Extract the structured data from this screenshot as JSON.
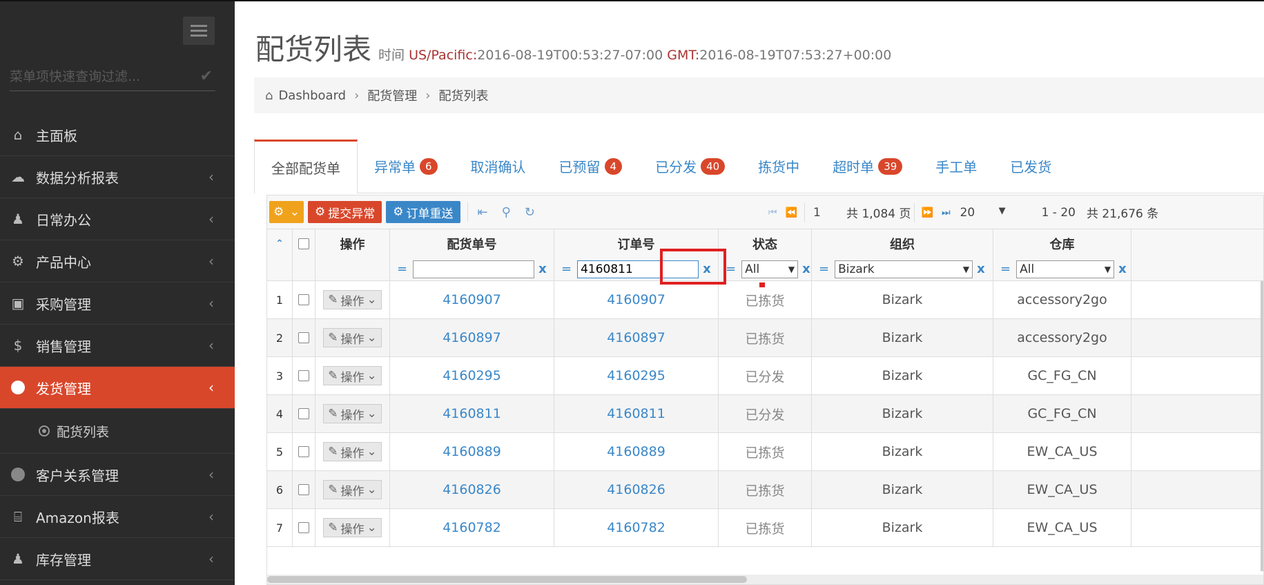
{
  "sidebar": {
    "search_placeholder": "菜单项快速查询过滤...",
    "items": [
      {
        "label": "主面板",
        "icon": "home-icon",
        "glyph": "⌂",
        "chevron": false
      },
      {
        "label": "数据分析报表",
        "icon": "cloud-icon",
        "glyph": "☁",
        "chevron": true
      },
      {
        "label": "日常办公",
        "icon": "android-icon",
        "glyph": "♟",
        "chevron": true
      },
      {
        "label": "产品中心",
        "icon": "gears-icon",
        "glyph": "⚙",
        "chevron": true
      },
      {
        "label": "采购管理",
        "icon": "cube-icon",
        "glyph": "▣",
        "chevron": true
      },
      {
        "label": "销售管理",
        "icon": "dollar-icon",
        "glyph": "$",
        "chevron": true
      },
      {
        "label": "发货管理",
        "icon": "circle-icon",
        "glyph": "",
        "chevron": true,
        "active": true
      },
      {
        "label": "客户关系管理",
        "icon": "circle-icon",
        "glyph": "",
        "chevron": true
      },
      {
        "label": "Amazon报表",
        "icon": "bank-icon",
        "glyph": "⌸",
        "chevron": true
      },
      {
        "label": "库存管理",
        "icon": "android-icon",
        "glyph": "♟",
        "chevron": true
      }
    ],
    "sub_item": "配货列表"
  },
  "header": {
    "title": "配货列表",
    "time_label": "时间",
    "tz1": "US/Pacific:",
    "time1": "2016-08-19T00:53:27-07:00",
    "tz2": "GMT:",
    "time2": "2016-08-19T07:53:27+00:00"
  },
  "breadcrumb": [
    "Dashboard",
    "配货管理",
    "配货列表"
  ],
  "tabs": [
    {
      "label": "全部配货单",
      "badge": "",
      "active": true
    },
    {
      "label": "异常单",
      "badge": "6"
    },
    {
      "label": "取消确认",
      "badge": ""
    },
    {
      "label": "已预留",
      "badge": "4"
    },
    {
      "label": "已分发",
      "badge": "40"
    },
    {
      "label": "拣货中",
      "badge": ""
    },
    {
      "label": "超时单",
      "badge": "39"
    },
    {
      "label": "手工单",
      "badge": ""
    },
    {
      "label": "已发货",
      "badge": ""
    }
  ],
  "toolbar": {
    "submit_exception": "提交异常",
    "resend_order": "订单重送"
  },
  "pager": {
    "page": "1",
    "total_pages": "共 1,084 页",
    "page_size": "20",
    "range": "1 - 20",
    "total": "共 21,676 条"
  },
  "columns": {
    "op": "操作",
    "alloc_no": "配货单号",
    "order_no": "订单号",
    "status": "状态",
    "org": "组织",
    "warehouse": "仓库"
  },
  "filters": {
    "alloc_no": "",
    "order_no": "4160811",
    "status": "All",
    "org": "Bizark",
    "warehouse": "All",
    "eq": "=",
    "clear": "x"
  },
  "op_label": "操作",
  "rows": [
    {
      "n": "1",
      "alloc": "4160907",
      "order": "4160907",
      "status": "已拣货",
      "org": "Bizark",
      "wh": "accessory2go"
    },
    {
      "n": "2",
      "alloc": "4160897",
      "order": "4160897",
      "status": "已拣货",
      "org": "Bizark",
      "wh": "accessory2go"
    },
    {
      "n": "3",
      "alloc": "4160295",
      "order": "4160295",
      "status": "已分发",
      "org": "Bizark",
      "wh": "GC_FG_CN"
    },
    {
      "n": "4",
      "alloc": "4160811",
      "order": "4160811",
      "status": "已分发",
      "org": "Bizark",
      "wh": "GC_FG_CN"
    },
    {
      "n": "5",
      "alloc": "4160889",
      "order": "4160889",
      "status": "已拣货",
      "org": "Bizark",
      "wh": "EW_CA_US"
    },
    {
      "n": "6",
      "alloc": "4160826",
      "order": "4160826",
      "status": "已拣货",
      "org": "Bizark",
      "wh": "EW_CA_US"
    },
    {
      "n": "7",
      "alloc": "4160782",
      "order": "4160782",
      "status": "已拣货",
      "org": "Bizark",
      "wh": "EW_CA_US"
    }
  ]
}
